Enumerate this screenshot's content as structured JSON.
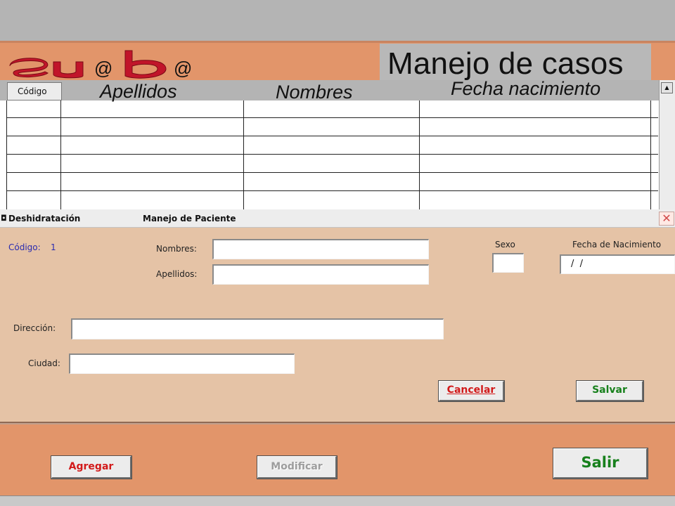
{
  "app": {
    "logo_text": "Su@b@",
    "title": "Manejo de casos"
  },
  "grid": {
    "columns": [
      "Código",
      "Apellidos",
      "Nombres",
      "Fecha nacimiento"
    ],
    "visible_rows": 6
  },
  "dialog": {
    "app_name": "Deshidratación",
    "title": "Manejo de Paciente",
    "codigo_label": "Código:",
    "codigo_value": "1",
    "nombres_label": "Nombres:",
    "nombres_value": "",
    "apellidos_label": "Apellidos:",
    "apellidos_value": "",
    "sexo_label": "Sexo",
    "sexo_value": "",
    "fecha_label": "Fecha de Nacimiento",
    "fecha_value": "/  /",
    "direccion_label": "Dirección:",
    "direccion_value": "",
    "ciudad_label": "Ciudad:",
    "ciudad_value": "",
    "cancelar_label": "Cancelar",
    "salvar_label": "Salvar"
  },
  "footer": {
    "agregar_label": "Agregar",
    "modificar_label": "Modificar",
    "salir_label": "Salir"
  },
  "colors": {
    "background": "#e2956a",
    "dialog": "#e5c3a6",
    "header_gray": "#b4b4b4",
    "cancel_red": "#d21a1a",
    "save_green": "#17801c",
    "label_blue": "#2a2bb0"
  },
  "icons": {
    "dialog_icon": "app-icon",
    "close": "close-icon"
  }
}
